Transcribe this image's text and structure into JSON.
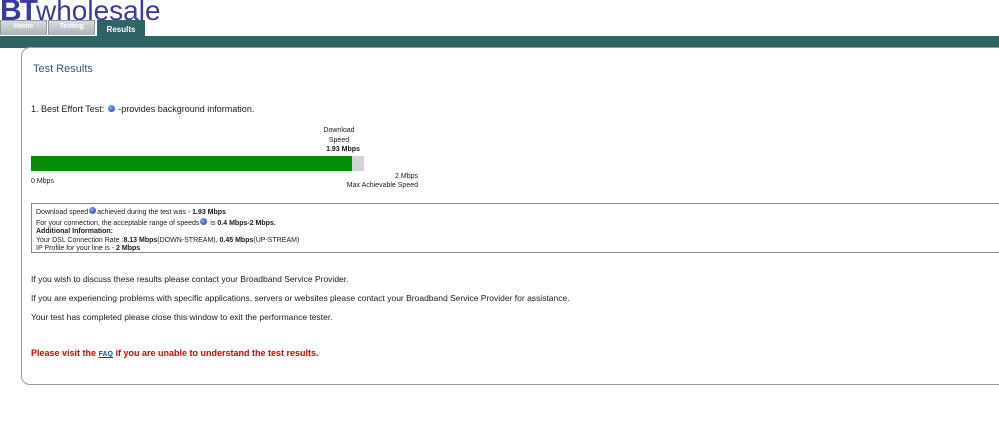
{
  "header": {
    "logo_bt": "BT",
    "logo_wholesale": "wholesale",
    "brand_color": "#3a3aa0",
    "band_color": "#2e6464"
  },
  "tabs": [
    {
      "label": "Home",
      "active": false
    },
    {
      "label": "Testing",
      "active": false
    },
    {
      "label": "Results",
      "active": true
    }
  ],
  "main": {
    "title": "Test Results",
    "test_prefix": "1. Best Effort Test:",
    "test_suffix": "-provides background information.",
    "gauge": {
      "label_line1": "Download",
      "label_line2": "Speed",
      "value_text": "1.93 Mbps",
      "value": 1.93,
      "max": 2,
      "min_label": "0 Mbps",
      "max_value": "2 Mbps",
      "max_label": "Max Achievable Speed",
      "fill_color": "#0a8a0a"
    },
    "info": {
      "line1_a": "Download speed",
      "line1_b": "achieved during the test was -",
      "line1_value": "1.93 Mbps",
      "line2_a": "For your connection, the acceptable range of speeds",
      "line2_b": "is",
      "line2_value": "0.4 Mbps-2 Mbps.",
      "line3": "Additional Information:",
      "line4_a": "Your DSL Connection Rate :",
      "line4_down": "8.13 Mbps",
      "line4_down_suffix": "(DOWN-STREAM),",
      "line4_up": "0.45 Mbps",
      "line4_up_suffix": "(UP-STREAM)",
      "line5_a": "IP Profile for your line is -",
      "line5_value": "2 Mbps"
    },
    "paragraphs": {
      "p1": "If you wish to discuss these results please contact your Broadband Service Provider.",
      "p2": "If you are experiencing problems with specific applications, servers or websites please contact your Broadband Service Provider for assistance.",
      "p3": "Your test has completed please close this window to exit the performance tester."
    },
    "faq": {
      "before": "Please visit the",
      "link": "FAQ",
      "after": "if you are unable to understand the test results."
    }
  }
}
